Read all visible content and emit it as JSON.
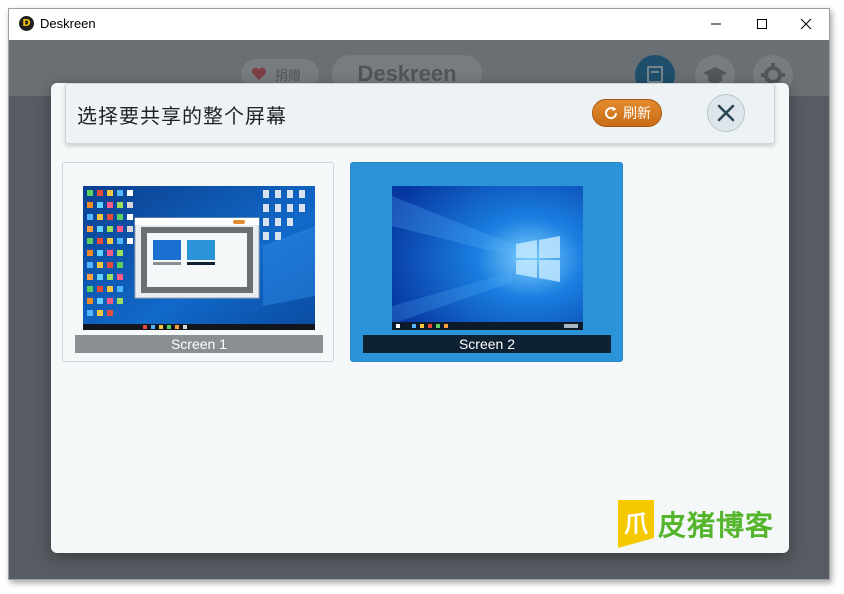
{
  "window": {
    "title": "Deskreen",
    "icon": "deskreen-logo-icon",
    "app_icon_letter": "D"
  },
  "background_app": {
    "donate_label": "捐赠",
    "brand_label": "Deskreen"
  },
  "dialog": {
    "title": "选择要共享的整个屏幕",
    "refresh_label": "刷新",
    "screens": [
      {
        "label": "Screen 1",
        "selected": false
      },
      {
        "label": "Screen 2",
        "selected": true
      }
    ]
  },
  "watermark": {
    "text": "皮猪博客",
    "logo_glyph": "爪"
  },
  "colors": {
    "accent": "#2b93d8",
    "refresh": "#d87b22",
    "dialog_bg": "#f4f8f9",
    "overlay": "#575c62"
  }
}
